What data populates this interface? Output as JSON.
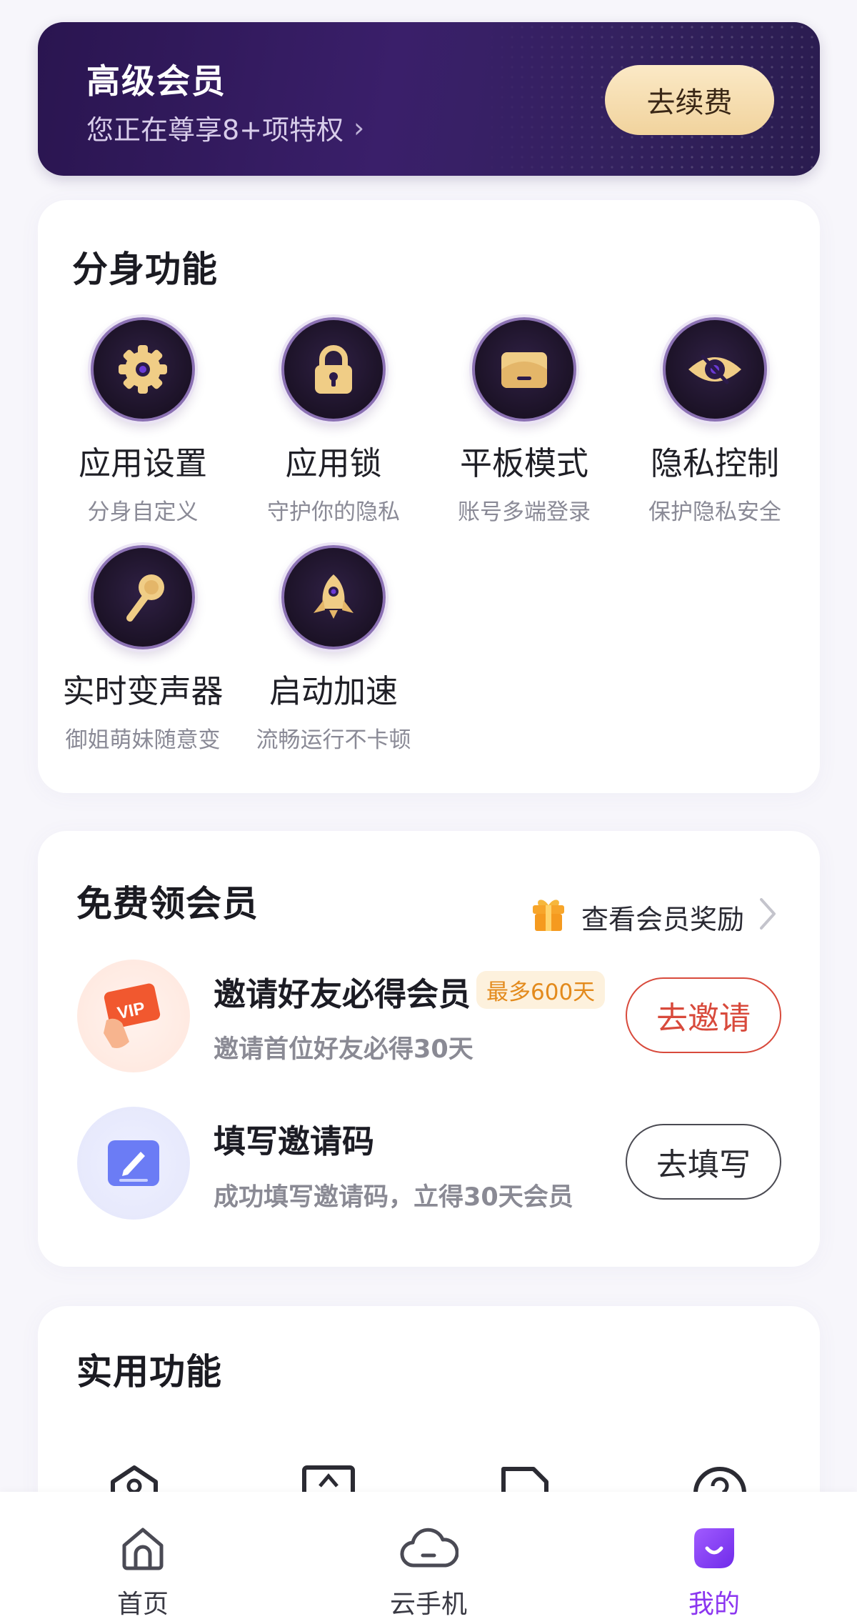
{
  "vip": {
    "title": "高级会员",
    "subtitle": "您正在尊享8+项特权",
    "renew_button": "去续费"
  },
  "clone_features": {
    "title": "分身功能",
    "items": [
      {
        "name": "应用设置",
        "desc": "分身自定义",
        "icon": "gear-icon"
      },
      {
        "name": "应用锁",
        "desc": "守护你的隐私",
        "icon": "lock-icon"
      },
      {
        "name": "平板模式",
        "desc": "账号多端登录",
        "icon": "tablet-icon"
      },
      {
        "name": "隐私控制",
        "desc": "保护隐私安全",
        "icon": "eye-slash-icon"
      },
      {
        "name": "实时变声器",
        "desc": "御姐萌妹随意变",
        "icon": "microphone-icon"
      },
      {
        "name": "启动加速",
        "desc": "流畅运行不卡顿",
        "icon": "rocket-icon"
      }
    ]
  },
  "free_member": {
    "title": "免费领会员",
    "rewards_link": "查看会员奖励",
    "rows": [
      {
        "title": "邀请好友必得会员",
        "badge": "最多600天",
        "subtitle": "邀请首位好友必得30天",
        "button": "去邀请"
      },
      {
        "title": "填写邀请码",
        "subtitle": "成功填写邀请码，立得30天会员",
        "button": "去填写"
      }
    ]
  },
  "utility": {
    "title": "实用功能"
  },
  "nav": {
    "items": [
      {
        "label": "首页",
        "icon": "home-icon"
      },
      {
        "label": "云手机",
        "icon": "cloud-icon"
      },
      {
        "label": "我的",
        "icon": "mine-icon"
      }
    ],
    "active_index": 2
  },
  "colors": {
    "accent": "#8b35f0",
    "vip_bg": "#2a1550",
    "gold": "#f1d39d",
    "invite_red": "#d84a3c"
  }
}
